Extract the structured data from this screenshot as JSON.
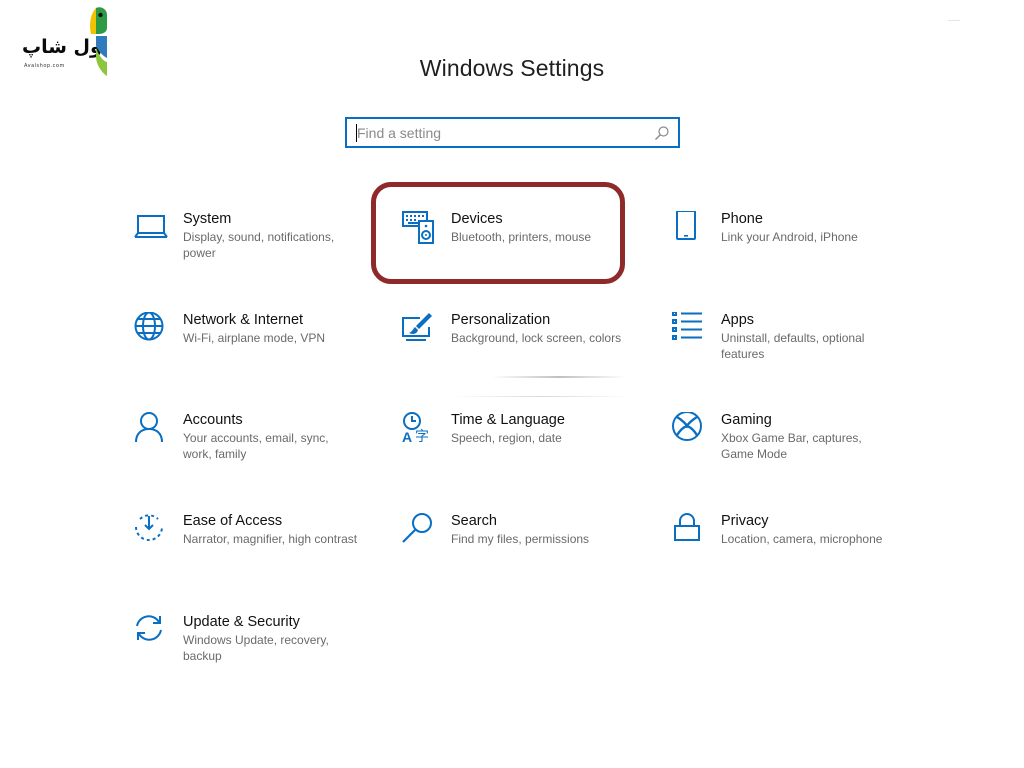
{
  "logo": {
    "text": "اول شاپ",
    "subtext": "Avalshop.com"
  },
  "window": {
    "title": "Windows Settings"
  },
  "search": {
    "placeholder": "Find a setting",
    "value": ""
  },
  "colors": {
    "accent": "#0a6fc2",
    "highlight_border": "#8e2a2a"
  },
  "tiles": [
    {
      "name": "System",
      "desc": "Display, sound, notifications, power",
      "icon": "laptop-icon"
    },
    {
      "name": "Devices",
      "desc": "Bluetooth, printers, mouse",
      "icon": "devices-icon"
    },
    {
      "name": "Phone",
      "desc": "Link your Android, iPhone",
      "icon": "phone-icon"
    },
    {
      "name": "Network & Internet",
      "desc": "Wi-Fi, airplane mode, VPN",
      "icon": "globe-icon"
    },
    {
      "name": "Personalization",
      "desc": "Background, lock screen, colors",
      "icon": "paint-brush-icon"
    },
    {
      "name": "Apps",
      "desc": "Uninstall, defaults, optional features",
      "icon": "apps-list-icon"
    },
    {
      "name": "Accounts",
      "desc": "Your accounts, email, sync, work, family",
      "icon": "person-icon"
    },
    {
      "name": "Time & Language",
      "desc": "Speech, region, date",
      "icon": "time-language-icon"
    },
    {
      "name": "Gaming",
      "desc": "Xbox Game Bar, captures, Game Mode",
      "icon": "xbox-icon"
    },
    {
      "name": "Ease of Access",
      "desc": "Narrator, magnifier, high contrast",
      "icon": "ease-of-access-icon"
    },
    {
      "name": "Search",
      "desc": "Find my files, permissions",
      "icon": "search-icon"
    },
    {
      "name": "Privacy",
      "desc": "Location, camera, microphone",
      "icon": "lock-icon"
    },
    {
      "name": "Update & Security",
      "desc": "Windows Update, recovery, backup",
      "icon": "sync-arrows-icon"
    }
  ]
}
